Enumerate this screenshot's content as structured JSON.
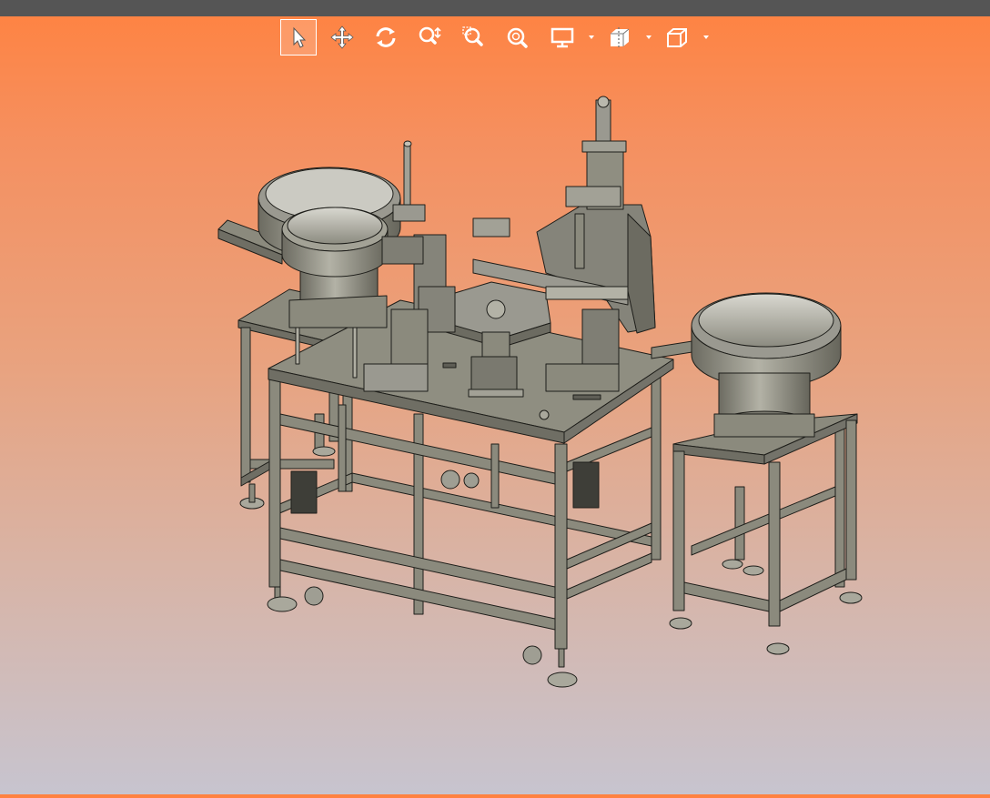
{
  "toolbar": {
    "tools": [
      {
        "icon": "select-arrow-icon",
        "active": true
      },
      {
        "icon": "pan-icon",
        "active": false
      },
      {
        "icon": "rotate-icon",
        "active": false
      },
      {
        "icon": "zoom-icon",
        "active": false
      },
      {
        "icon": "zoom-window-icon",
        "active": false
      },
      {
        "icon": "zoom-fit-icon",
        "active": false
      },
      {
        "icon": "display-mode-icon",
        "active": false,
        "dropdown": true
      },
      {
        "icon": "section-view-icon",
        "active": false,
        "dropdown": true
      },
      {
        "icon": "standard-views-cube-icon",
        "active": false,
        "dropdown": true
      }
    ]
  },
  "model": {
    "kind": "3D CAD assembly - automated assembly machine with vibratory bowl feeders and rotary index table",
    "colors": {
      "fill": "#8b8a7d",
      "fill_dark": "#6b6a60",
      "fill_light": "#a9a89c",
      "edge": "#1e1e1a"
    }
  }
}
